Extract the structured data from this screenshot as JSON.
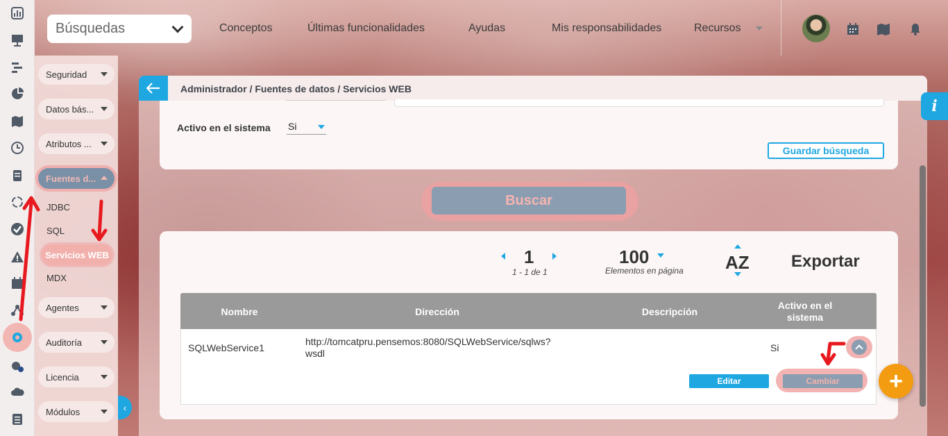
{
  "topbar": {
    "search_label": "Búsquedas",
    "nav": [
      "Conceptos",
      "Últimas funcionalidades",
      "Ayudas",
      "Mis responsabilidades",
      "Recursos"
    ]
  },
  "sidebar": {
    "items": [
      {
        "label": "Seguridad"
      },
      {
        "label": "Datos bás..."
      },
      {
        "label": "Atributos ..."
      },
      {
        "label": "Fuentes d..."
      },
      {
        "label": "Agentes"
      },
      {
        "label": "Auditoría"
      },
      {
        "label": "Licencia"
      },
      {
        "label": "Módulos"
      }
    ],
    "subitems": [
      "JDBC",
      "SQL",
      "Servicios WEB",
      "MDX"
    ]
  },
  "breadcrumb": "Administrador / Fuentes de datos / Servicios WEB",
  "filters": {
    "active_label": "Activo en el sistema",
    "active_value": "Si",
    "save_search": "Guardar búsqueda",
    "search_button": "Buscar"
  },
  "pager": {
    "page": "1",
    "range": "1 - 1 de 1",
    "per_page": "100",
    "per_page_label": "Elementos en página",
    "sort": "AZ",
    "export": "Exportar"
  },
  "table": {
    "headers": [
      "Nombre",
      "Dirección",
      "Descripción",
      "Activo en el sistema"
    ],
    "rows": [
      {
        "nombre": "SQLWebService1",
        "direccion_1": "http://tomcatpru.pensemos:8080/SQLWebService/sqlws?",
        "direccion_2": "wsdl",
        "descripcion": "",
        "activo": "Si"
      }
    ],
    "edit_button": "Editar",
    "change_button": "Cambiar"
  },
  "fab": "+",
  "info": "i",
  "colors": {
    "accent": "#1ea7e1",
    "fab": "#f39c12",
    "annotation": "#e8191e",
    "button_muted": "#8b9db0"
  }
}
